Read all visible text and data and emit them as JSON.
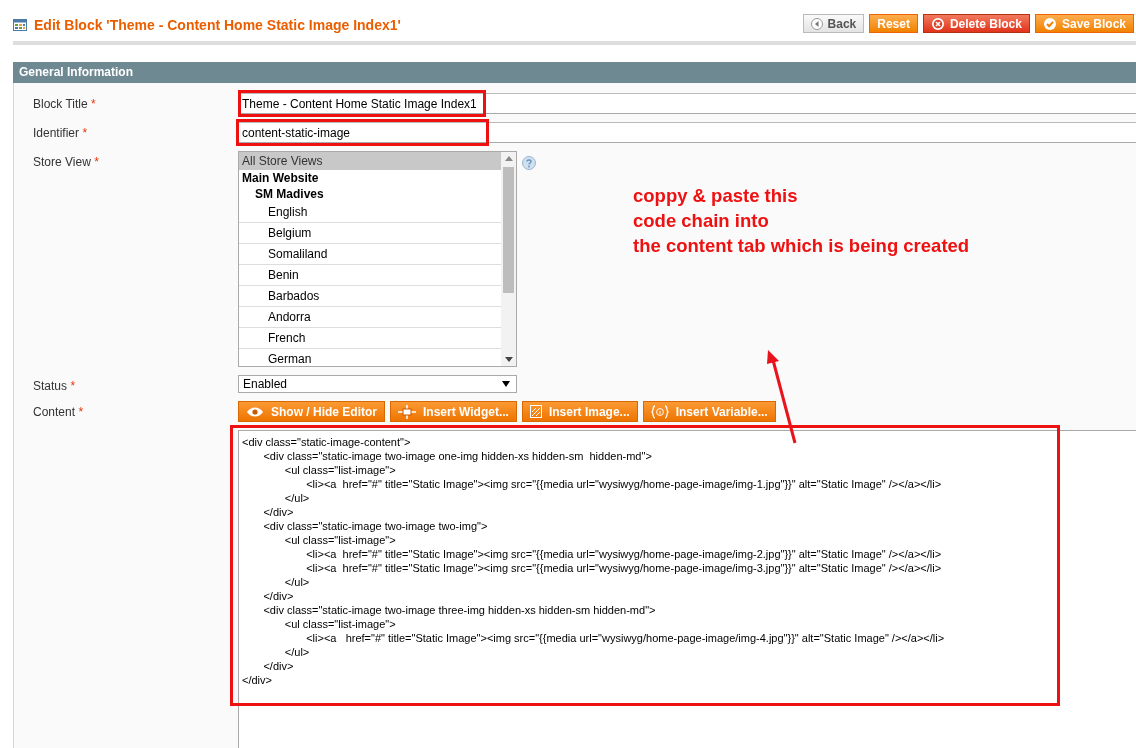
{
  "header": {
    "title": "Edit Block 'Theme - Content Home Static Image Index1'",
    "buttons": [
      {
        "label": "Back",
        "kind": "back"
      },
      {
        "label": "Reset",
        "kind": "plain"
      },
      {
        "label": "Delete Block",
        "kind": "delete"
      },
      {
        "label": "Save Block",
        "kind": "save"
      }
    ]
  },
  "section": {
    "title": "General Information"
  },
  "fields": [
    {
      "kind": "text",
      "label": "Block Title",
      "required_mark": "*",
      "value": "Theme - Content Home Static Image Index1",
      "highlighted": true
    },
    {
      "kind": "text",
      "label": "Identifier",
      "required_mark": "*",
      "value": "content-static-image",
      "highlighted": true
    },
    {
      "kind": "multiselect",
      "label": "Store View",
      "required_mark": "*",
      "options": [
        {
          "label": "All Store Views",
          "selected": true
        },
        {
          "label": "Main Website",
          "selected": false,
          "children": [
            {
              "label": "SM Madives",
              "selected": false,
              "children": [
                {
                  "label": "English",
                  "selected": false
                },
                {
                  "label": "Belgium",
                  "selected": false
                },
                {
                  "label": "Somaliland",
                  "selected": false
                },
                {
                  "label": "Benin",
                  "selected": false
                },
                {
                  "label": "Barbados",
                  "selected": false
                },
                {
                  "label": "Andorra",
                  "selected": false
                },
                {
                  "label": "French",
                  "selected": false
                },
                {
                  "label": "German",
                  "selected": false
                }
              ]
            }
          ]
        }
      ]
    },
    {
      "kind": "select",
      "label": "Status",
      "required_mark": "*",
      "value": "Enabled"
    },
    {
      "kind": "content",
      "label": "Content",
      "required_mark": "*",
      "highlighted": true,
      "buttons": [
        {
          "label": "Show / Hide Editor",
          "kind": "eye"
        },
        {
          "label": "Insert Widget...",
          "kind": "widget"
        },
        {
          "label": "Insert Image...",
          "kind": "image"
        },
        {
          "label": "Insert Variable...",
          "kind": "variable"
        }
      ],
      "value": "<div class=\"static-image-content\">\n\t<div class=\"static-image two-image one-img hidden-xs hidden-sm  hidden-md\">\n\t\t<ul class=\"list-image\">\n\t\t\t<li><a  href=\"#\" title=\"Static Image\"><img src=\"{{media url=\"wysiwyg/home-page-image/img-1.jpg\"}}\" alt=\"Static Image\" /></a></li>\n\t\t</ul>\n\t</div>\n\t<div class=\"static-image two-image two-img\">\n\t\t<ul class=\"list-image\">\n\t\t\t<li><a  href=\"#\" title=\"Static Image\"><img src=\"{{media url=\"wysiwyg/home-page-image/img-2.jpg\"}}\" alt=\"Static Image\" /></a></li>\n\t\t\t<li><a  href=\"#\" title=\"Static Image\"><img src=\"{{media url=\"wysiwyg/home-page-image/img-3.jpg\"}}\" alt=\"Static Image\" /></a></li>\n\t\t</ul>\n\t</div>\n\t<div class=\"static-image two-image three-img hidden-xs hidden-sm hidden-md\">\n\t\t<ul class=\"list-image\">\n\t\t\t<li><a   href=\"#\" title=\"Static Image\"><img src=\"{{media url=\"wysiwyg/home-page-image/img-4.jpg\"}}\" alt=\"Static Image\" /></a></li>\n\t\t</ul>\n\t</div>\n</div>"
    }
  ],
  "annotation": {
    "lines": [
      "coppy & paste this",
      "code chain into",
      "the content tab which is being created"
    ]
  }
}
